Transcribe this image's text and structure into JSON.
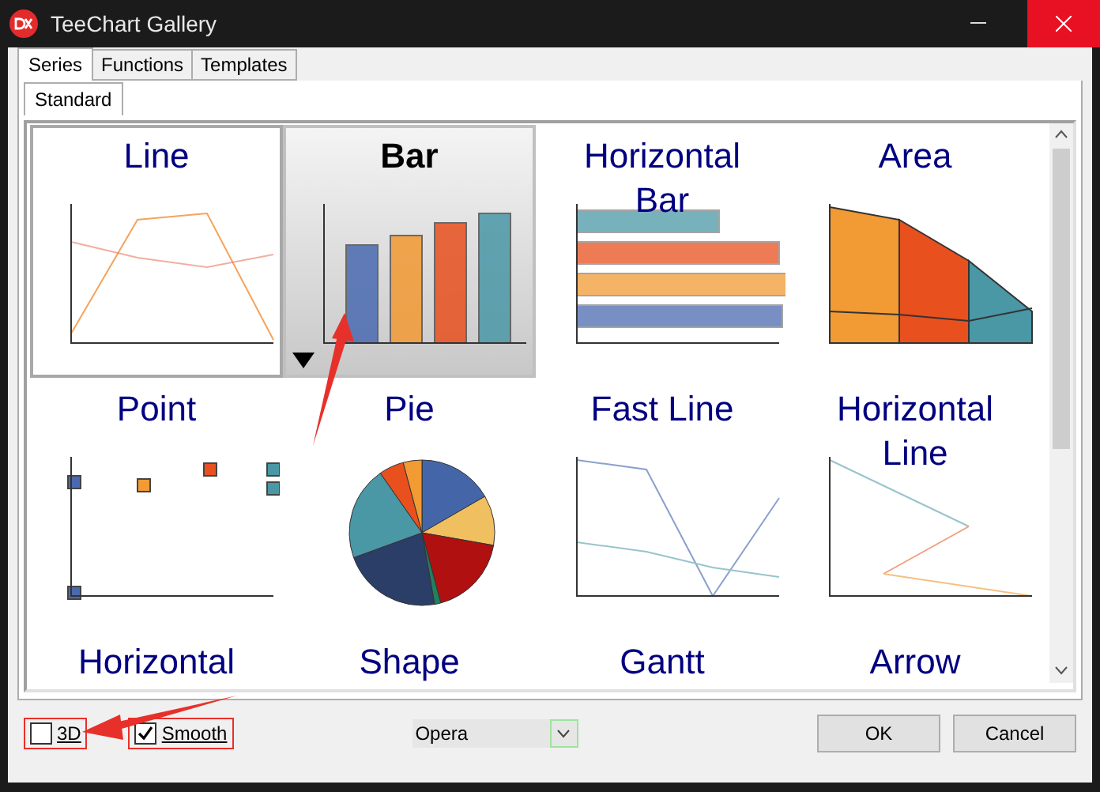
{
  "window": {
    "title": "TeeChart Gallery"
  },
  "tabs": [
    {
      "label": "Series",
      "selected": true
    },
    {
      "label": "Functions",
      "selected": false
    },
    {
      "label": "Templates",
      "selected": false
    }
  ],
  "subtabs": [
    {
      "label": "Standard",
      "selected": true
    }
  ],
  "gallery": [
    {
      "title": "Line",
      "kind": "line",
      "selected": false,
      "focused": true
    },
    {
      "title": "Bar",
      "kind": "bar",
      "selected": true,
      "focused": false
    },
    {
      "title": "Horizontal Bar",
      "kind": "hbar",
      "selected": false,
      "focused": false
    },
    {
      "title": "Area",
      "kind": "area",
      "selected": false,
      "focused": false
    },
    {
      "title": "Point",
      "kind": "point",
      "selected": false,
      "focused": false
    },
    {
      "title": "Pie",
      "kind": "pie",
      "selected": false,
      "focused": false
    },
    {
      "title": "Fast Line",
      "kind": "fastline",
      "selected": false,
      "focused": false
    },
    {
      "title": "Horizontal Line",
      "kind": "hline",
      "selected": false,
      "focused": false
    },
    {
      "title": "Horizontal",
      "selected": false,
      "focused": false
    },
    {
      "title": "Shape",
      "selected": false,
      "focused": false
    },
    {
      "title": "Gantt",
      "selected": false,
      "focused": false
    },
    {
      "title": "Arrow",
      "selected": false,
      "focused": false
    }
  ],
  "options": [
    {
      "label": "3D",
      "checked": false
    },
    {
      "label": "Smooth",
      "checked": true
    }
  ],
  "theme_select": {
    "value": "Opera"
  },
  "buttons": [
    "OK",
    "Cancel"
  ]
}
